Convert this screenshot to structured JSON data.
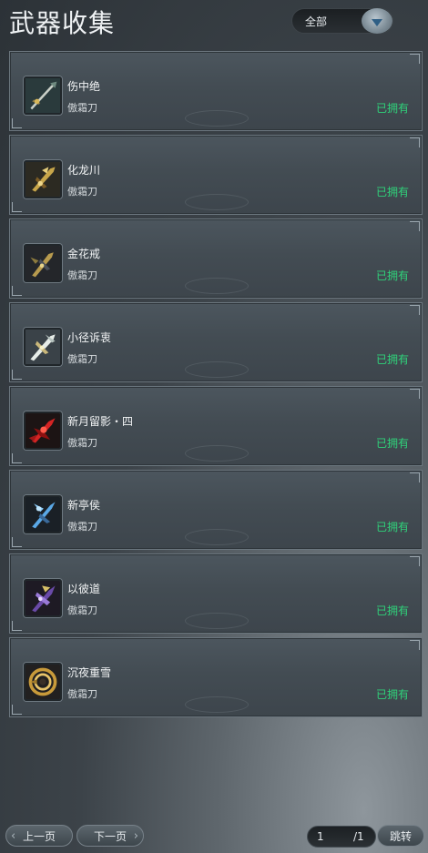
{
  "header": {
    "title": "武器收集"
  },
  "filter": {
    "selected": "全部"
  },
  "weapons": [
    {
      "name": "伤中绝",
      "class": "傲霜刀",
      "status": "已拥有",
      "icon": "sword-icon"
    },
    {
      "name": "化龙川",
      "class": "傲霜刀",
      "status": "已拥有",
      "icon": "dragon-blade-icon"
    },
    {
      "name": "金花戒",
      "class": "傲霜刀",
      "status": "已拥有",
      "icon": "golden-blade-icon"
    },
    {
      "name": "小径诉衷",
      "class": "傲霜刀",
      "status": "已拥有",
      "icon": "silver-blade-icon"
    },
    {
      "name": "新月留影・四",
      "class": "傲霜刀",
      "status": "已拥有",
      "icon": "red-blade-icon"
    },
    {
      "name": "新亭侯",
      "class": "傲霜刀",
      "status": "已拥有",
      "icon": "blue-blade-icon"
    },
    {
      "name": "以彼道",
      "class": "傲霜刀",
      "status": "已拥有",
      "icon": "purple-blade-icon"
    },
    {
      "name": "沉夜重雪",
      "class": "傲霜刀",
      "status": "已拥有",
      "icon": "vortex-blade-icon"
    }
  ],
  "pagination": {
    "prev_label": "上一页",
    "next_label": "下一页",
    "current_page": "1",
    "total_pages": "/1",
    "jump_label": "跳转"
  },
  "colors": {
    "owned": "#2fd27a",
    "accent": "#2f5f85"
  }
}
